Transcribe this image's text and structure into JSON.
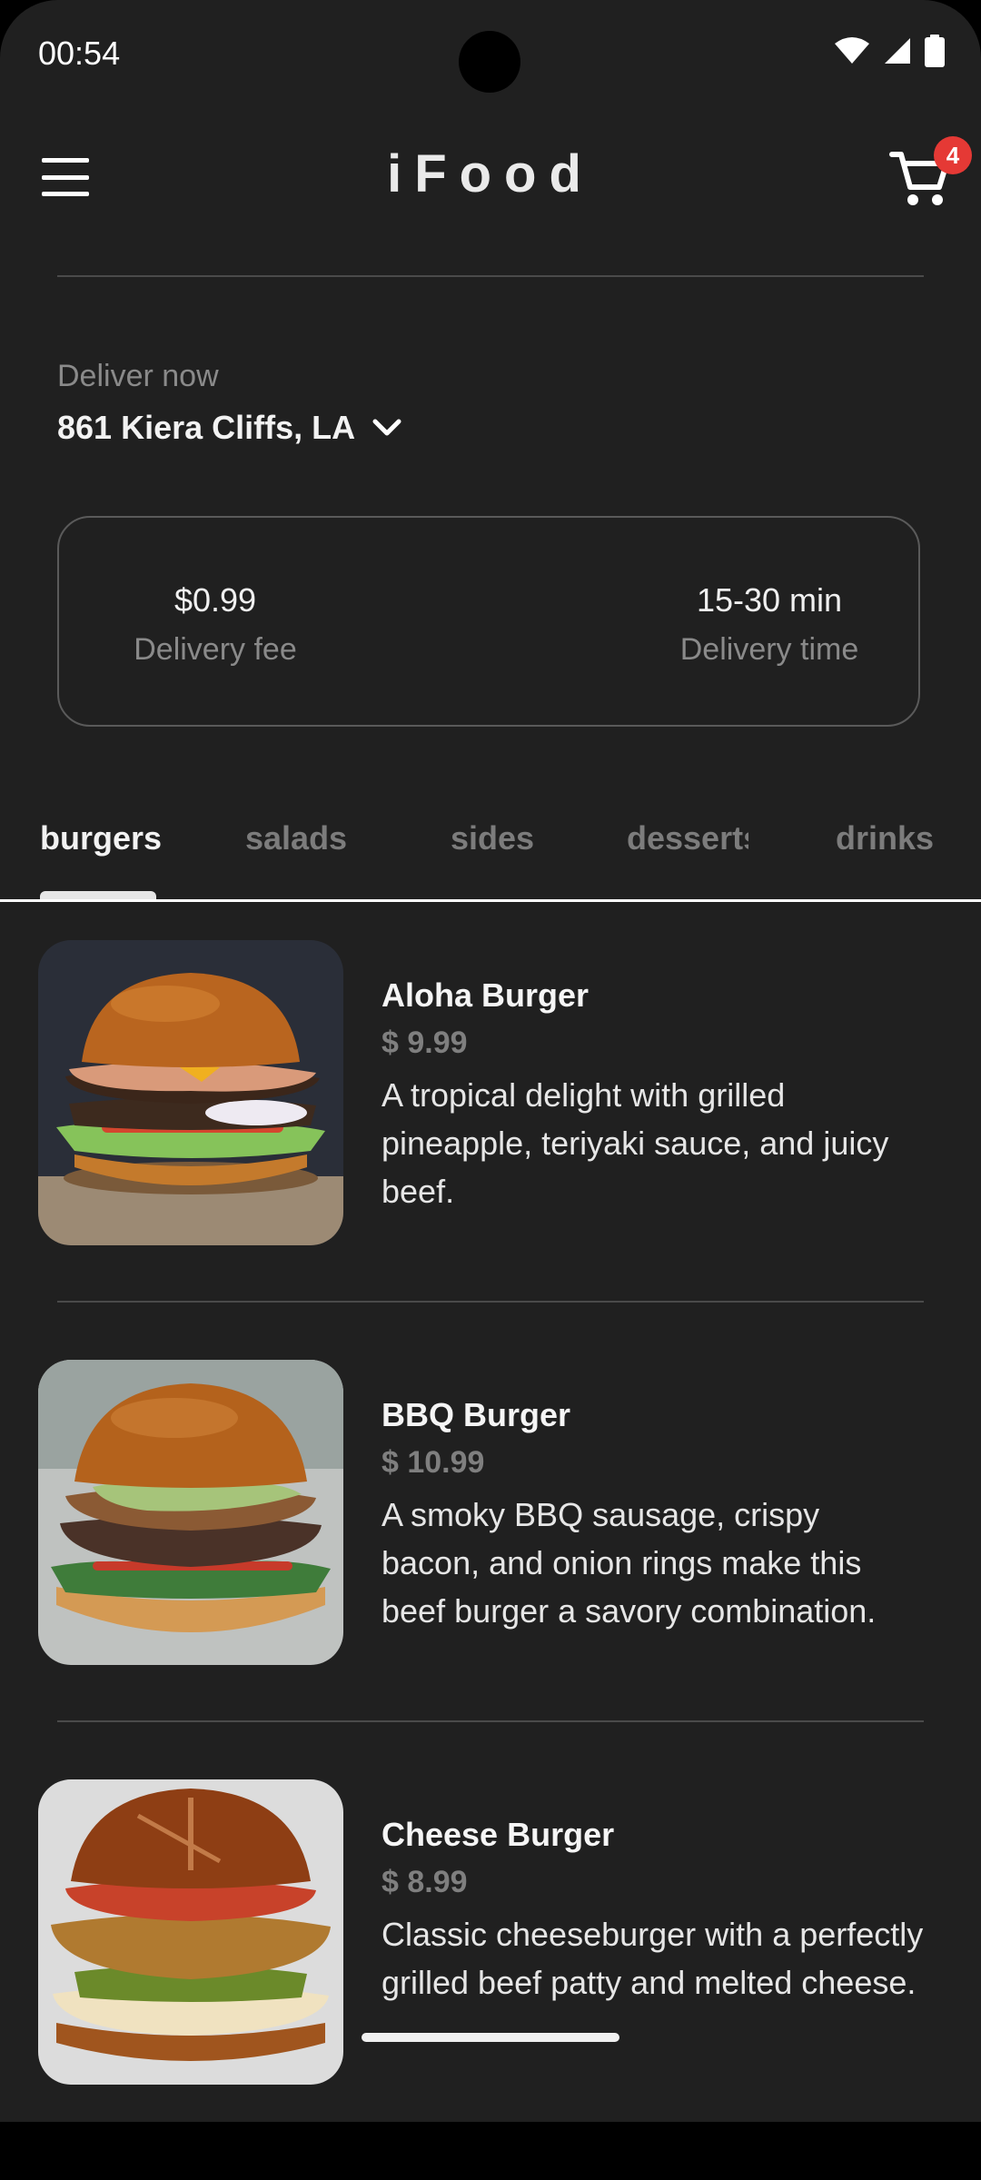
{
  "status_bar": {
    "time": "00:54"
  },
  "app_bar": {
    "title": "iFood",
    "cart_count": "4"
  },
  "delivery": {
    "label": "Deliver now",
    "address": "861 Kiera Cliffs, LA",
    "fee_value": "$0.99",
    "fee_label": "Delivery fee",
    "time_value": "15-30 min",
    "time_label": "Delivery time"
  },
  "tabs": [
    {
      "label": "burgers",
      "active": true
    },
    {
      "label": "salads",
      "active": false
    },
    {
      "label": "sides",
      "active": false
    },
    {
      "label": "desserts",
      "active": false
    },
    {
      "label": "drinks",
      "active": false
    }
  ],
  "menu_items": [
    {
      "name": "Aloha Burger",
      "price": "$ 9.99",
      "description": "A tropical delight with grilled pineapple, teriyaki sauce, and juicy beef."
    },
    {
      "name": "BBQ Burger",
      "price": "$ 10.99",
      "description": "A smoky BBQ sausage, crispy bacon, and onion rings make this beef burger a savory combination."
    },
    {
      "name": "Cheese Burger",
      "price": "$ 8.99",
      "description": "Classic cheeseburger with a perfectly grilled beef patty and melted cheese."
    }
  ],
  "colors": {
    "background": "#202020",
    "badge": "#e53935",
    "muted_text": "#8a8a8a"
  }
}
